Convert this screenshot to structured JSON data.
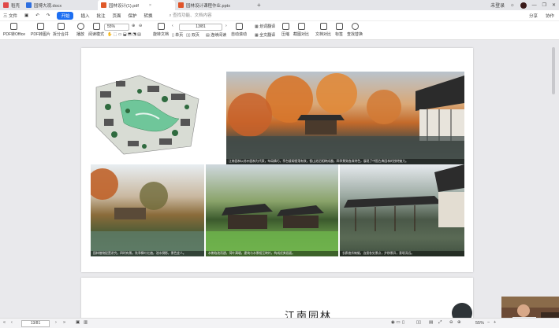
{
  "tabs": [
    {
      "label": "稻壳",
      "color": "#e04848",
      "active": false
    },
    {
      "label": "园博大观.docx",
      "color": "#2e6fe0",
      "active": false
    },
    {
      "label": "园林设计(1).pdf",
      "color": "#e05a2a",
      "active": true
    },
    {
      "label": "园林设计课程作业.pptx",
      "color": "#e0542a",
      "active": false
    }
  ],
  "window": {
    "user": "未登录"
  },
  "menu": {
    "items": [
      "三 文件",
      "开始",
      "插入",
      "批注",
      "页面",
      "保护",
      "转换"
    ],
    "active": "开始",
    "search": "查找功能、文档内容",
    "right": [
      "分享",
      "协作"
    ]
  },
  "toolbar": {
    "pdf_office": "PDF转Office",
    "pdf_image": "PDF转图片",
    "split_merge": "拆分合并",
    "play": "播放",
    "read_mode": "阅读模式",
    "zoom": "55%",
    "page_indicator": "13/81",
    "rotate": "旋转文档",
    "single": "单页",
    "double": "双页",
    "continuous": "连续阅读",
    "auto_scroll": "自动滚动",
    "translate_menu": "划词翻译",
    "full_translate": "全文翻译",
    "compress": "压缩",
    "screenshot_compare": "截图对比",
    "text_compare": "文档对比",
    "note": "标签",
    "find": "查找替换"
  },
  "page1": {
    "caption_top": "江南园林以苏州园林为代表，布局精巧，亭台楼阁错落有致，假山池沼相映成趣，四季景致各具特色，展现了中国古典园林的独特魅力。",
    "caption_1": "园林植物配置讲究，四时有景。秋季枫叶红遍，池水倒影，景色宜人。",
    "caption_2": "水榭临池而建，荷叶满塘，建筑与水景相互映衬，构成优美画面。",
    "caption_3": "长廊曲折蜿蜒，连接各处景点，步移景异，意境深远。"
  },
  "page2": {
    "title": "江南园林"
  },
  "status": {
    "page_input": "13/81",
    "zoom": "55%"
  }
}
